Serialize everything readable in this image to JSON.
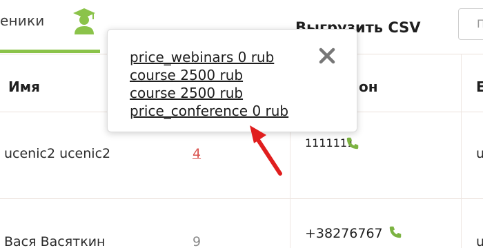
{
  "tab": {
    "label": "еники",
    "icon": "graduate-user-icon"
  },
  "toolbar": {
    "export_label": "Выгрузить CSV",
    "search_placeholder": "П"
  },
  "table": {
    "headers": [
      "Имя",
      "он",
      "Е"
    ],
    "rows": [
      {
        "name": "ucenic2 ucenic2",
        "count": "4",
        "phone": "1111111",
        "extra": "u"
      },
      {
        "name": "Вася Васяткин",
        "count": "9",
        "phone": "+38276767",
        "extra": "u"
      }
    ]
  },
  "popover": {
    "items": [
      "price_webinars 0 rub",
      "course 2500 rub",
      "course 2500 rub",
      "price_conference 0 rub"
    ],
    "close_icon": "close-icon"
  },
  "colors": {
    "accent": "#8bc34a",
    "link_red": "#d9534f",
    "arrow": "#e01e1e",
    "phone_green": "#7cb342"
  }
}
